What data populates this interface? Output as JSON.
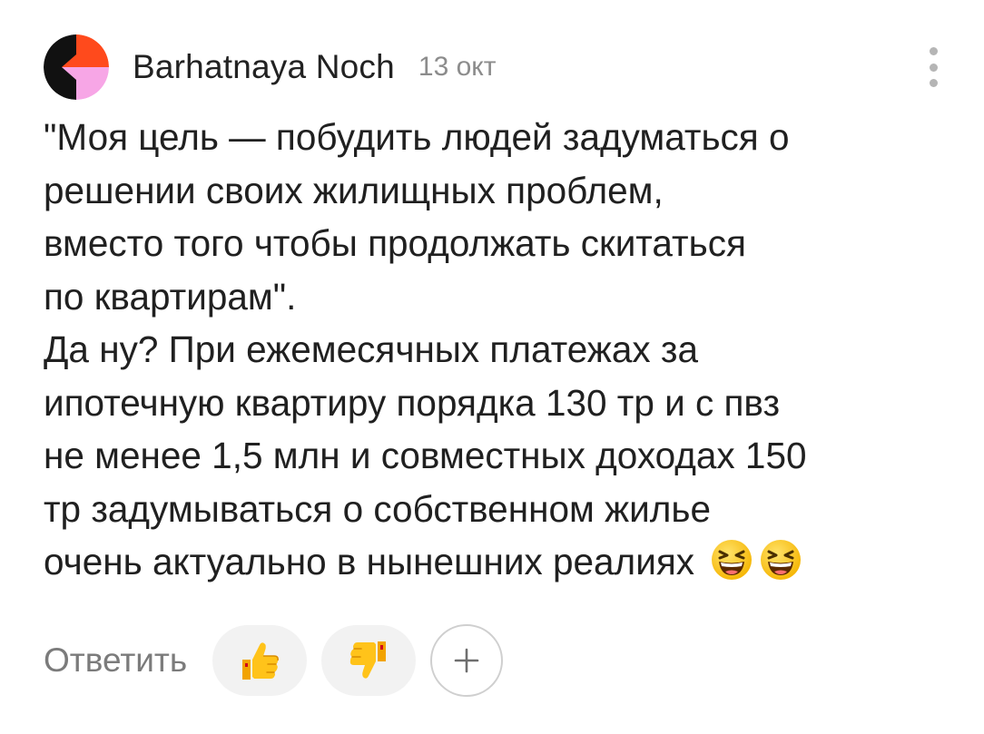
{
  "comment": {
    "author": "Barhatnaya Noch",
    "date": "13 окт",
    "avatar_icon": "author-avatar",
    "more_icon": "more-vertical-icon",
    "text_lines": [
      "\"Моя цель — побудить людей задуматься о",
      "решении своих жилищных проблем,",
      "вместо того чтобы продолжать скитаться",
      "по квартирам\".",
      "Да ну? При ежемесячных платежах за",
      "ипотечную квартиру порядка 130 тр и с пвз",
      "не менее 1,5 млн и совместных доходах 150",
      "тр задумываться о собственном жилье",
      "очень актуально в нынешних реалиях"
    ],
    "trailing_emojis": [
      "laughing-face-emoji",
      "laughing-face-emoji"
    ]
  },
  "actions": {
    "reply_label": "Ответить",
    "like_icon": "thumbs-up-icon",
    "dislike_icon": "thumbs-down-icon",
    "add_reaction_icon": "plus-icon"
  },
  "colors": {
    "author": "#222222",
    "date": "#8c8c8c",
    "text": "#202020",
    "reply": "#7b7b7b",
    "pill_bg": "#f2f2f2",
    "avatar_orange": "#ff4a1c",
    "avatar_pink": "#f7a6e6",
    "avatar_black": "#111111"
  }
}
